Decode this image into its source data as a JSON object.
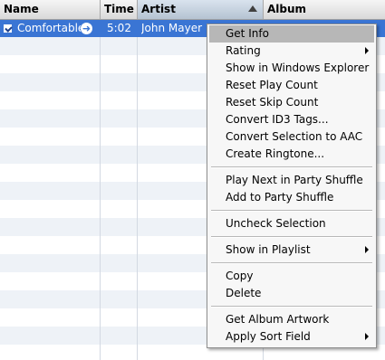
{
  "columns": {
    "name": "Name",
    "time": "Time",
    "artist": "Artist",
    "album": "Album"
  },
  "selected_track": {
    "name": "Comfortable",
    "time": "5:02",
    "artist": "John Mayer"
  },
  "context_menu": {
    "get_info": "Get Info",
    "rating": "Rating",
    "show_in_explorer": "Show in Windows Explorer",
    "reset_play_count": "Reset Play Count",
    "reset_skip_count": "Reset Skip Count",
    "convert_id3": "Convert ID3 Tags...",
    "convert_aac": "Convert Selection to AAC",
    "create_ringtone": "Create Ringtone...",
    "play_next_party": "Play Next in Party Shuffle",
    "add_party": "Add to Party Shuffle",
    "uncheck_selection": "Uncheck Selection",
    "show_in_playlist": "Show in Playlist",
    "copy": "Copy",
    "delete": "Delete",
    "get_album_artwork": "Get Album Artwork",
    "apply_sort_field": "Apply Sort Field"
  },
  "colors": {
    "selection": "#3a75d4",
    "menu_highlight": "#b7b7b7",
    "stripe": "#eef2f7"
  }
}
